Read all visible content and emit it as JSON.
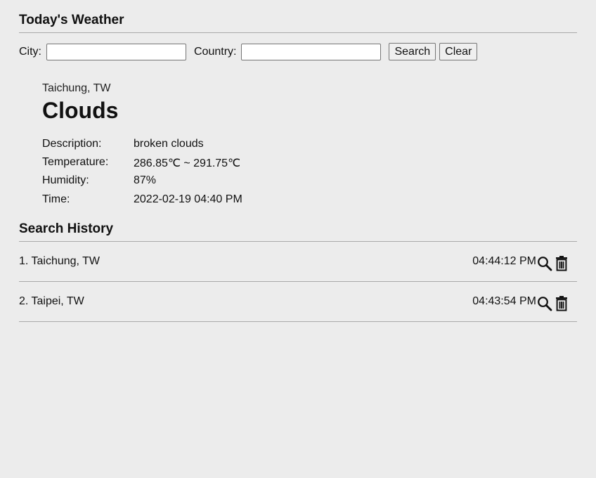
{
  "header": {
    "title": "Today's Weather"
  },
  "search": {
    "city_label": "City:",
    "city_value": "",
    "country_label": "Country:",
    "country_value": "",
    "search_button": "Search",
    "clear_button": "Clear"
  },
  "weather": {
    "location": "Taichung, TW",
    "main": "Clouds",
    "details": [
      {
        "label": "Description:",
        "value": "broken clouds"
      },
      {
        "label": "Temperature:",
        "value": "286.85℃ ~ 291.75℃"
      },
      {
        "label": "Humidity:",
        "value": "87%"
      },
      {
        "label": "Time:",
        "value": "2022-02-19 04:40 PM"
      }
    ]
  },
  "history": {
    "title": "Search History",
    "items": [
      {
        "label": "1. Taichung, TW",
        "time": "04:44:12 PM"
      },
      {
        "label": "2. Taipei, TW",
        "time": "04:43:54 PM"
      }
    ]
  },
  "icons": {
    "search": "search-icon",
    "delete": "trash-icon"
  }
}
